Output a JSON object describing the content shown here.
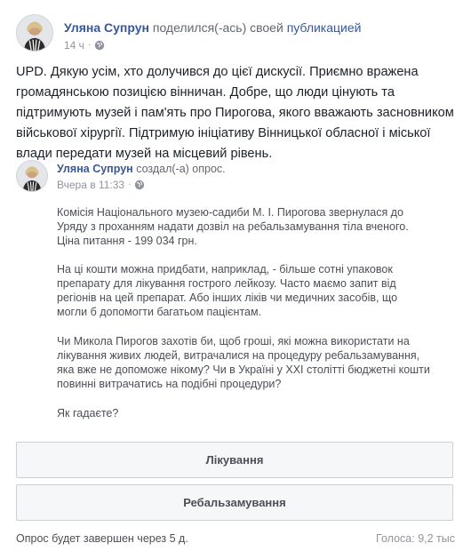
{
  "post": {
    "author": "Уляна Супрун",
    "action_text": "поделился(-ась) своей",
    "action_link": "публикацией",
    "time": "14 ч",
    "separator": "·",
    "audience_icon": "globe-icon",
    "text": "UPD. Дякую усім, хто долучився до цієї дискусії. Приємно вражена громадянською позицією вінничан. Добре, що люди цінують та підтримують музей і пам'ять про Пирогова, якого вважають засновником військової хірургії. Підтримую ініціативу Вінницької обласної і міської влади передати музей на місцевий рівень."
  },
  "shared": {
    "author": "Уляна Супрун",
    "action_text": "создал(-а) опрос.",
    "time": "Вчера в 11:33",
    "separator": "·",
    "audience_icon": "globe-icon",
    "paragraphs": [
      "Комісія Національного музею-садиби М. І. Пирогова звернулася до Уряду з проханням надати дозвіл на ребальзамування тіла вченого. Ціна питання - 199 034 грн.",
      "На ці кошти можна придбати, наприклад, - більше сотні упаковок препарату для лікування гострого лейкозу. Часто маємо запит від регіонів на цей препарат. Або інших ліків чи медичних засобів, що могли б допомогти багатьом пацієнтам.",
      "Чи Микола Пирогов захотів би, щоб гроші, які можна використати на лікування живих людей, витрачалися на процедуру ребальзамування, яка вже не допоможе нікому? Чи в Україні у XXI столітті бюджетні кошти повинні витрачатись на подібні процедури?",
      "Як гадаєте?"
    ]
  },
  "poll": {
    "options": [
      "Лікування",
      "Ребальзамування"
    ],
    "status": "Опрос будет завершен через 5 д.",
    "votes": "Голоса: 9,2 тыс"
  },
  "colors": {
    "link": "#365899",
    "text": "#1d2129",
    "muted": "#90949c",
    "option_bg": "#f6f7f9",
    "option_border": "#ccd0d5"
  }
}
